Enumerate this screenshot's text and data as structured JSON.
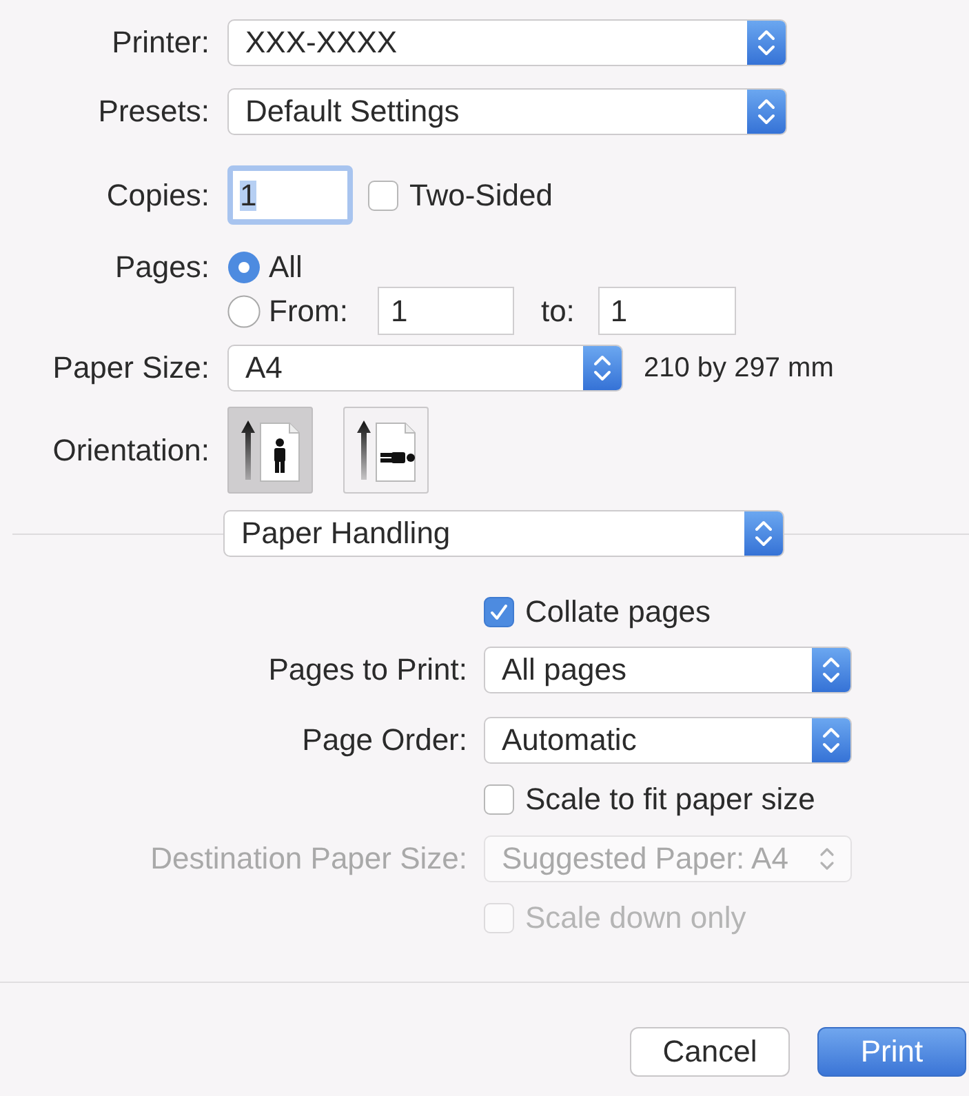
{
  "printer": {
    "label": "Printer:",
    "value": "XXX-XXXX"
  },
  "presets": {
    "label": "Presets:",
    "value": "Default Settings"
  },
  "copies": {
    "label": "Copies:",
    "value": "1",
    "focused": true
  },
  "two_sided": {
    "label": "Two-Sided",
    "checked": false
  },
  "pages": {
    "label": "Pages:",
    "options": [
      {
        "kind": "all",
        "label": "All",
        "selected": true
      },
      {
        "kind": "range",
        "label": "From:",
        "selected": false,
        "from": "1",
        "to_label": "to:",
        "to": "1"
      }
    ]
  },
  "paper_size": {
    "label": "Paper Size:",
    "value": "A4",
    "dimensions": "210 by 297 mm"
  },
  "orientation": {
    "label": "Orientation:",
    "options": [
      {
        "kind": "portrait",
        "selected": true
      },
      {
        "kind": "landscape",
        "selected": false
      }
    ]
  },
  "panel_menu": {
    "value": "Paper Handling"
  },
  "paper_handling": {
    "items": [
      {
        "kind": "checkbox",
        "label": "Collate pages",
        "checked": true,
        "disabled": false
      },
      {
        "kind": "popup",
        "label": "Pages to Print:",
        "value": "All pages",
        "disabled": false
      },
      {
        "kind": "popup",
        "label": "Page Order:",
        "value": "Automatic",
        "disabled": false
      },
      {
        "kind": "checkbox",
        "label": "Scale to fit paper size",
        "checked": false,
        "disabled": false
      },
      {
        "kind": "popup",
        "label": "Destination Paper Size:",
        "value": "Suggested Paper: A4",
        "disabled": true
      },
      {
        "kind": "checkbox",
        "label": "Scale down only",
        "checked": false,
        "disabled": true
      }
    ]
  },
  "buttons": [
    {
      "label": "Cancel",
      "kind": "secondary"
    },
    {
      "label": "Print",
      "kind": "default"
    }
  ]
}
